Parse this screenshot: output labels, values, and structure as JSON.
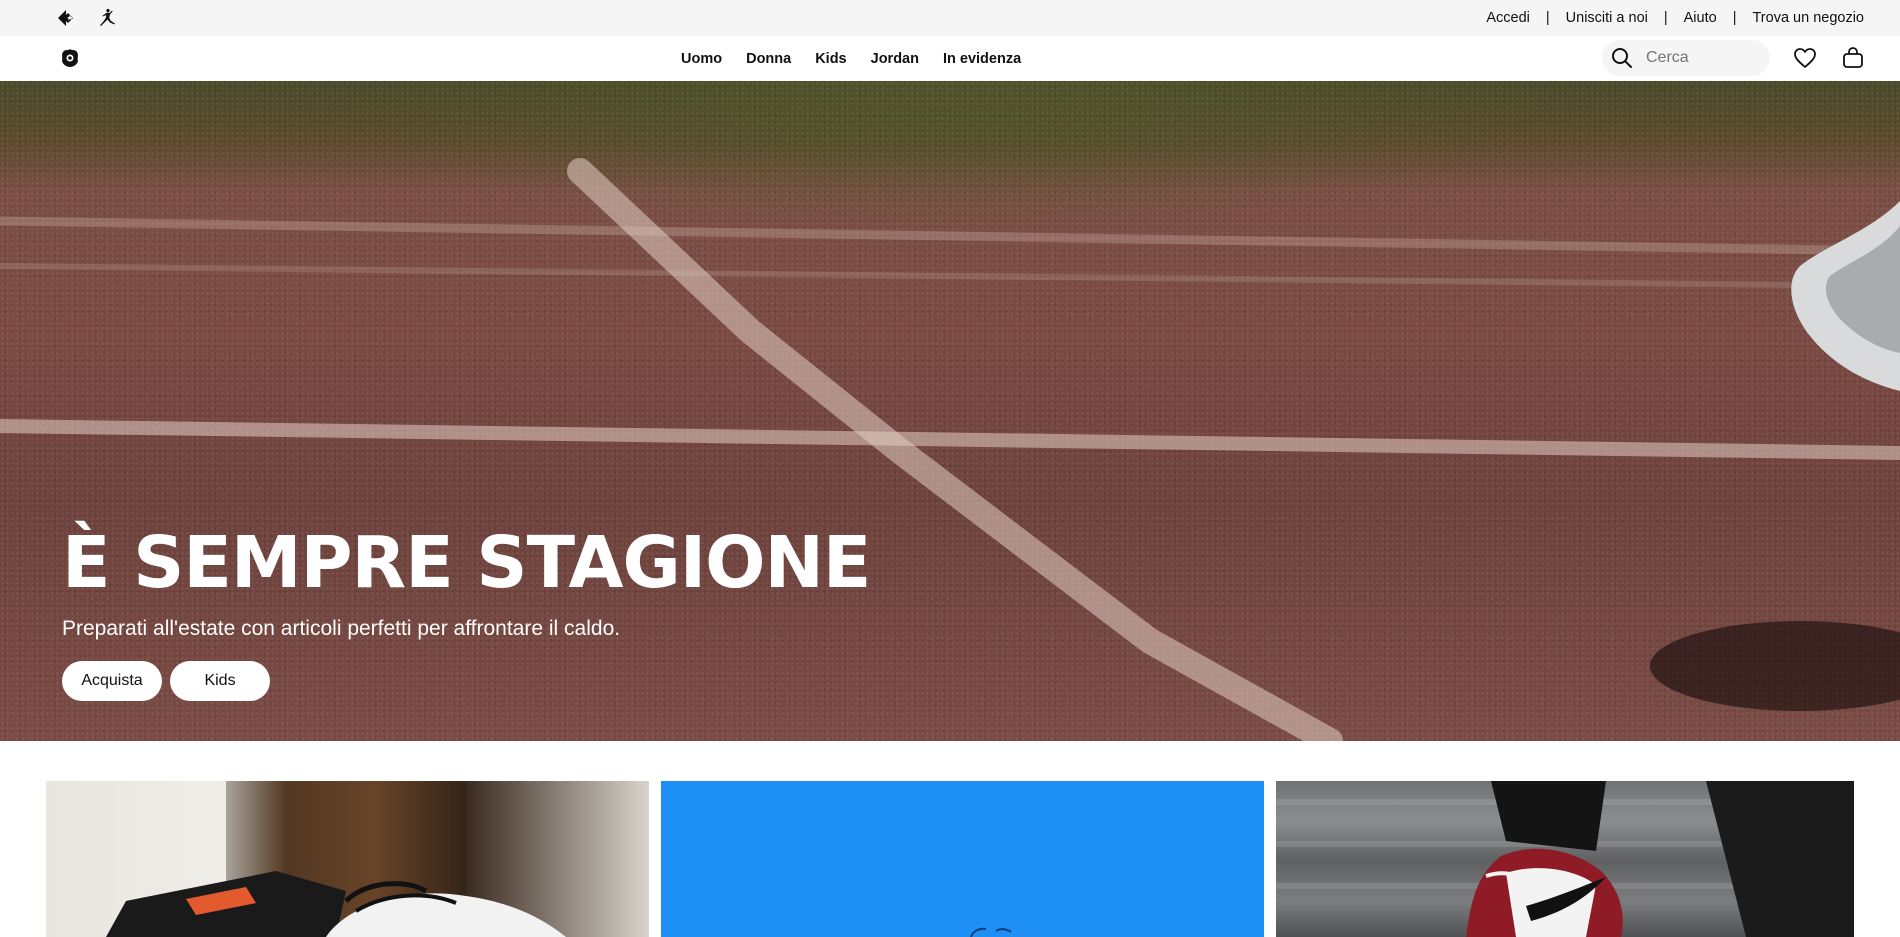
{
  "utility_bar": {
    "brand_icons": [
      "converse-icon",
      "jordan-jumpman-icon"
    ],
    "links": [
      {
        "label": "Accedi"
      },
      {
        "label": "Unisciti a noi"
      },
      {
        "label": "Aiuto"
      },
      {
        "label": "Trova un negozio"
      }
    ],
    "separator": "|"
  },
  "main_nav": {
    "logo_icon": "brand-logo-icon",
    "links": [
      {
        "label": "Uomo"
      },
      {
        "label": "Donna"
      },
      {
        "label": "Kids"
      },
      {
        "label": "Jordan"
      },
      {
        "label": "In evidenza"
      }
    ],
    "search": {
      "placeholder": "Cerca",
      "value": ""
    },
    "icons": [
      "heart-icon",
      "bag-icon"
    ]
  },
  "hero": {
    "title": "È SEMPRE STAGIONE",
    "subtitle": "Preparati all'estate con articoli perfetti per affrontare il caldo.",
    "buttons": [
      {
        "label": "Acquista"
      },
      {
        "label": "Kids"
      }
    ]
  },
  "promo_tiles": [
    {
      "name": "promo-tile-sneaker-box"
    },
    {
      "name": "promo-tile-blue"
    },
    {
      "name": "promo-tile-jordan"
    }
  ],
  "colors": {
    "utility_bg": "#f5f5f5",
    "promo_blue": "#1e8ff5",
    "hero_track": "#7a4a43",
    "text": "#111111"
  }
}
